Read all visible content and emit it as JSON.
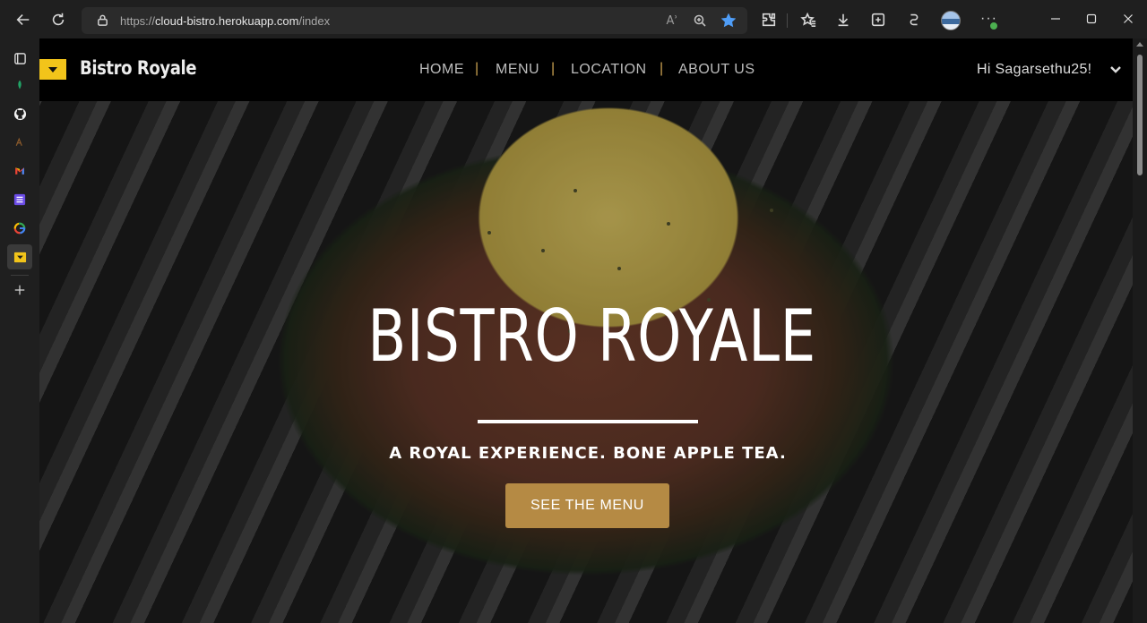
{
  "browser": {
    "url_prefix": "https://",
    "url_host": "cloud-bistro.herokuapp.com",
    "url_path": "/index",
    "read_aloud_label": "Aʾ"
  },
  "sidebar": {
    "items": [
      "tabs-icon",
      "leaf-icon",
      "github-icon",
      "app-icon",
      "gmail-icon",
      "list-icon",
      "google-icon",
      "bistro-icon",
      "add-icon"
    ]
  },
  "site": {
    "brand": "Bistro Royale",
    "nav": [
      "HOME",
      "MENU",
      "LOCATION",
      "ABOUT US"
    ],
    "separator": "|",
    "greeting": "Hi Sagarsethu25!",
    "logo_color": "#f2c41a",
    "accent": "#c8a050"
  },
  "hero": {
    "title": "BISTRO ROYALE",
    "tagline": "A ROYAL EXPERIENCE. BONE APPLE TEA.",
    "cta": "SEE THE MENU",
    "cta_color": "#b58a44"
  }
}
